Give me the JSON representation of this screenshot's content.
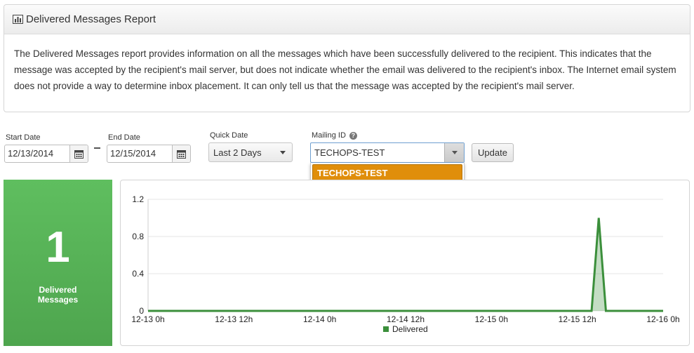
{
  "report": {
    "title": "Delivered Messages Report",
    "description": "The Delivered Messages report provides information on all the messages which have been successfully delivered to the recipient. This indicates that the message was accepted by the recipient's mail server, but does not indicate whether the email was delivered to the recipient's inbox. The Internet email system does not provide a way to determine inbox placement. It can only tell us that the message was accepted by the recipient's mail server.",
    "icon": "bar-chart-icon"
  },
  "filters": {
    "start_date_label": "Start Date",
    "start_date_value": "12/13/2014",
    "end_date_label": "End Date",
    "end_date_value": "12/15/2014",
    "quick_date_label": "Quick Date",
    "quick_date_value": "Last 2 Days",
    "mailing_id_label": "Mailing ID",
    "mailing_id_value": "TECHOPS-TEST",
    "mailing_id_options": [
      "TECHOPS-TEST"
    ],
    "update_label": "Update"
  },
  "summary": {
    "count": "1",
    "label": "Delivered Messages",
    "color": "#56b156"
  },
  "chart_data": {
    "type": "area",
    "title": "",
    "xlabel": "",
    "ylabel": "",
    "ylim": [
      0,
      1.2
    ],
    "yticks": [
      "0",
      "0.4",
      "0.8",
      "1.2"
    ],
    "x_ticks": [
      "12-13 0h",
      "12-13 12h",
      "12-14 0h",
      "12-14 12h",
      "12-15 0h",
      "12-15 12h",
      "12-16 0h"
    ],
    "x_range_hours": [
      0,
      72
    ],
    "grid": true,
    "legend": "bottom-center",
    "series": [
      {
        "name": "Delivered",
        "color": "#3b8f3b",
        "points": [
          {
            "x": 0,
            "y": 0
          },
          {
            "x": 62,
            "y": 0
          },
          {
            "x": 63,
            "y": 1
          },
          {
            "x": 64,
            "y": 0
          },
          {
            "x": 72,
            "y": 0
          }
        ]
      }
    ]
  }
}
